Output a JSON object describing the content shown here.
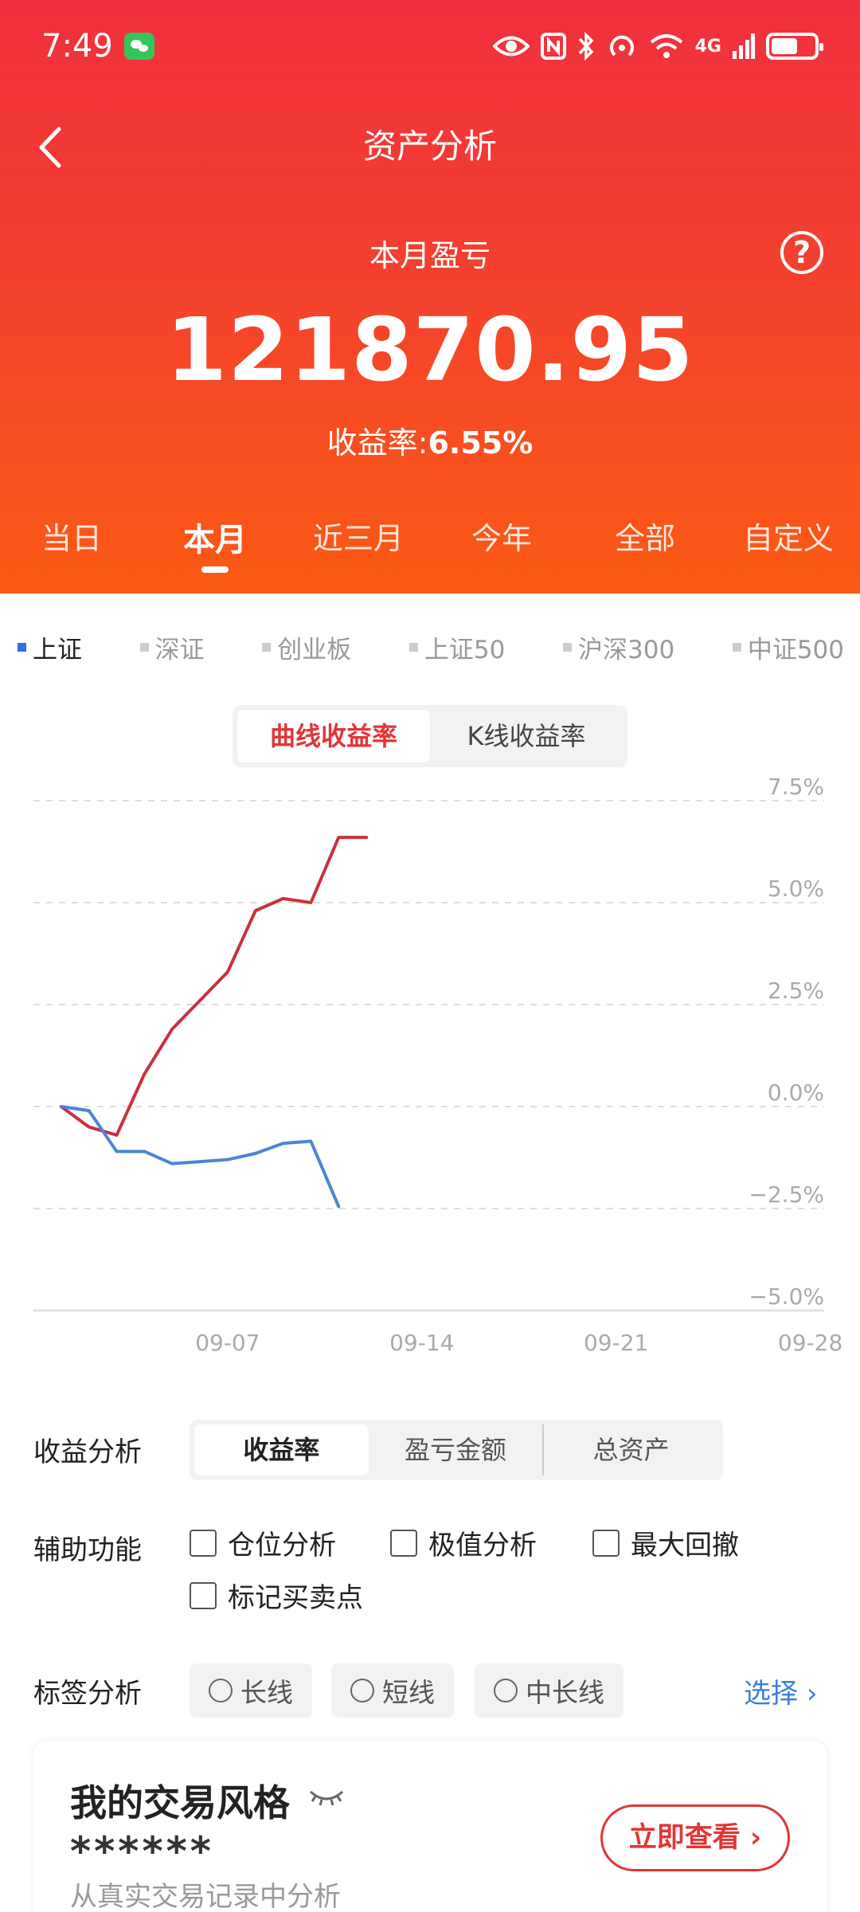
{
  "status": {
    "time": "7:49",
    "network": "4G"
  },
  "header": {
    "title": "资产分析",
    "subtitle": "本月盈亏",
    "amount": "121870.95",
    "rate_label": "收益率:",
    "rate_value": "6.55%",
    "help": "?"
  },
  "period_tabs": [
    {
      "label": "当日",
      "active": false
    },
    {
      "label": "本月",
      "active": true
    },
    {
      "label": "近三月",
      "active": false
    },
    {
      "label": "今年",
      "active": false
    },
    {
      "label": "全部",
      "active": false
    },
    {
      "label": "自定义",
      "active": false
    }
  ],
  "indices": [
    {
      "label": "上证",
      "active": true
    },
    {
      "label": "深证",
      "active": false
    },
    {
      "label": "创业板",
      "active": false
    },
    {
      "label": "上证50",
      "active": false
    },
    {
      "label": "沪深300",
      "active": false
    },
    {
      "label": "中证500",
      "active": false
    }
  ],
  "chart_toggle": {
    "curve": "曲线收益率",
    "kline": "K线收益率"
  },
  "colors": {
    "accent": "#e23535",
    "series_red": "#c9313d",
    "series_blue": "#4a86d4",
    "grid": "#dddddd"
  },
  "chart_data": {
    "type": "line",
    "y_ticks": [
      "7.5%",
      "5.0%",
      "2.5%",
      "0.0%",
      "−2.5%",
      "−5.0%"
    ],
    "x_ticks": [
      "09-07",
      "09-14",
      "09-21",
      "09-28"
    ],
    "ylim": [
      -5.0,
      7.5
    ],
    "x_range": [
      0,
      28.5
    ],
    "series": [
      {
        "color": "#c9313d",
        "x": [
          1,
          2,
          3,
          4,
          5,
          6,
          7,
          8,
          9,
          10,
          11,
          12
        ],
        "y": [
          0.0,
          -0.5,
          -0.7,
          0.8,
          1.9,
          2.6,
          3.3,
          4.8,
          5.1,
          5.0,
          6.6,
          6.6
        ]
      },
      {
        "color": "#4a86d4",
        "x": [
          1,
          2,
          3,
          4,
          5,
          6,
          7,
          8,
          9,
          10,
          11
        ],
        "y": [
          0.0,
          -0.1,
          -1.1,
          -1.1,
          -1.4,
          -1.35,
          -1.3,
          -1.15,
          -0.9,
          -0.85,
          -2.45
        ]
      }
    ]
  },
  "analysis": {
    "label": "收益分析",
    "tabs": [
      {
        "label": "收益率",
        "active": true
      },
      {
        "label": "盈亏金额",
        "active": false
      },
      {
        "label": "总资产",
        "active": false
      }
    ]
  },
  "aux": {
    "label": "辅助功能",
    "checks": [
      "仓位分析",
      "极值分析",
      "最大回撤",
      "标记买卖点"
    ]
  },
  "tags": {
    "label": "标签分析",
    "items": [
      "长线",
      "短线",
      "中长线"
    ],
    "select": "选择"
  },
  "style_card": {
    "title": "我的交易风格",
    "masked": "******",
    "desc": "从真实交易记录中分析",
    "cta": "立即查看"
  }
}
